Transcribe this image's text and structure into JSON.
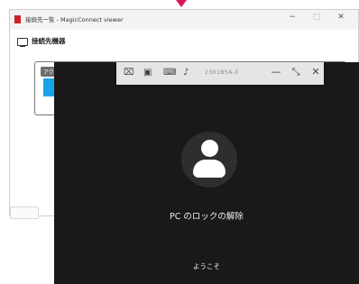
{
  "window": {
    "title": "接続先一覧 - MagicConnect viewer",
    "min": "−",
    "max": "□",
    "close": "✕",
    "section_title": "接続先機器",
    "badge": "アクティブ"
  },
  "remote": {
    "toolbar": {
      "host": "2301B5A-X",
      "min": "—",
      "restore": "⤡",
      "close": "✕"
    },
    "unlock_text": "PC のロックの解除",
    "welcome_text": "ようこそ"
  },
  "colors": {
    "accent_arrow": "#d6175e",
    "app_icon": "#d21f1f",
    "thumbnail": "#1aa3e8",
    "remote_bg": "#191919"
  }
}
